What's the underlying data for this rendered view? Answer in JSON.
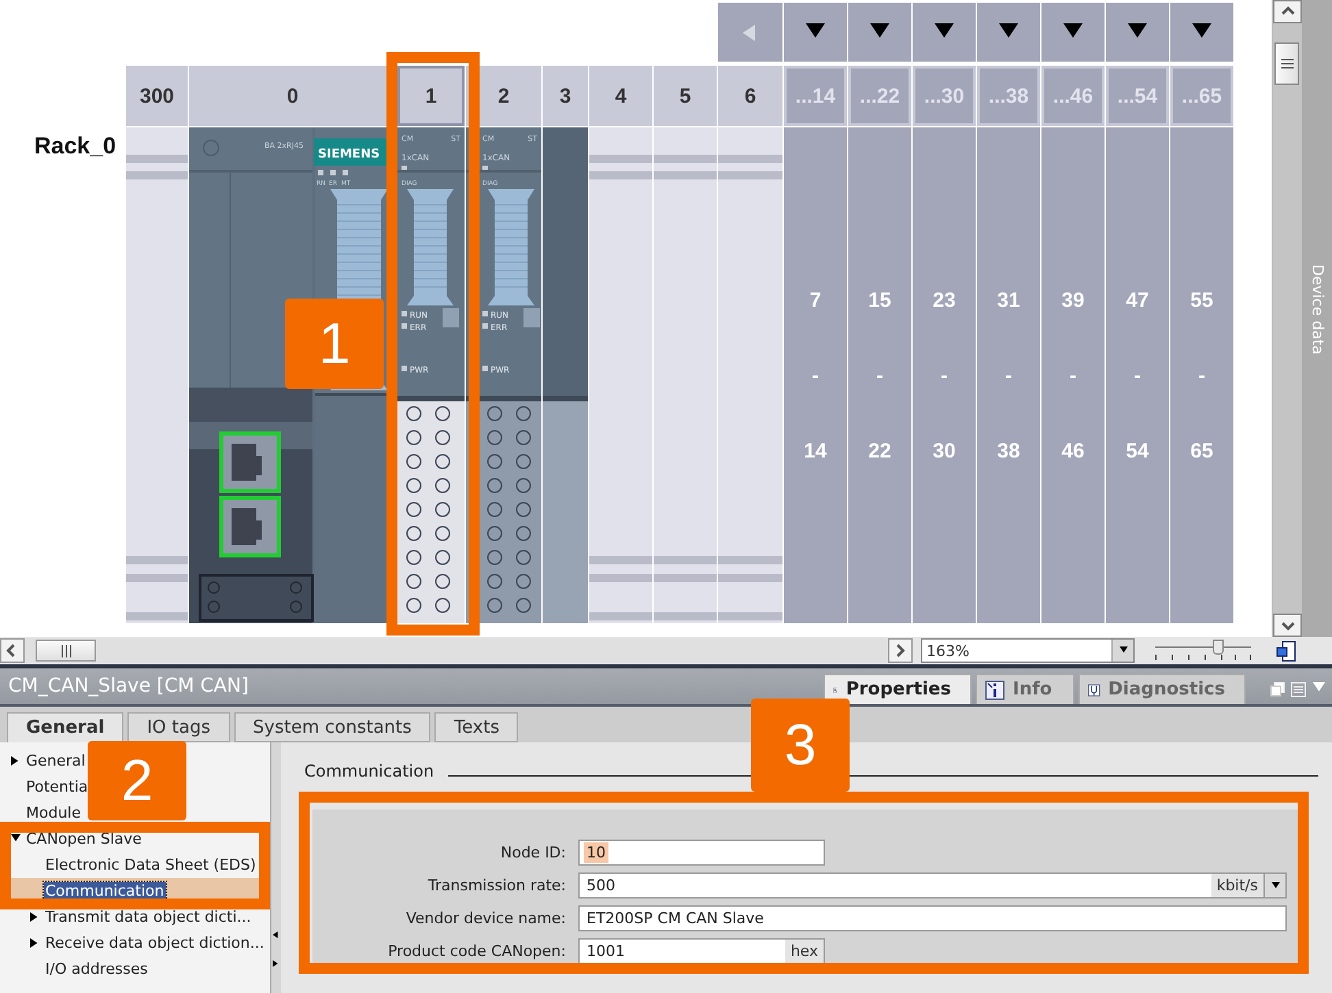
{
  "device_view": {
    "rack": {
      "name": "Rack_0",
      "slots": [
        {
          "label": "300",
          "kind": "empty",
          "selected": false
        },
        {
          "label": "0",
          "kind": "interface",
          "selected": false,
          "module": {
            "name": "BA 2xRJ45",
            "brand": "SIEMENS",
            "leds": [
              "RN",
              "ER",
              "MT"
            ]
          }
        },
        {
          "label": "1",
          "kind": "can",
          "selected": true,
          "module": {
            "class": "CM",
            "status": "ST",
            "type": "1xCAN",
            "diag": "DIAG",
            "run": "RUN",
            "err": "ERR",
            "pwr": "PWR"
          }
        },
        {
          "label": "2",
          "kind": "can",
          "selected": false,
          "module": {
            "class": "CM",
            "status": "ST",
            "type": "1xCAN",
            "diag": "DIAG",
            "run": "RUN",
            "err": "ERR",
            "pwr": "PWR"
          }
        },
        {
          "label": "3",
          "kind": "server",
          "selected": false
        },
        {
          "label": "4",
          "kind": "empty",
          "selected": false
        },
        {
          "label": "5",
          "kind": "empty",
          "selected": false
        },
        {
          "label": "6",
          "kind": "empty",
          "selected": false
        }
      ],
      "groups": [
        {
          "label": "...14",
          "from": "7",
          "dash": "-",
          "to": "14"
        },
        {
          "label": "...22",
          "from": "15",
          "dash": "-",
          "to": "22"
        },
        {
          "label": "...30",
          "from": "23",
          "dash": "-",
          "to": "30"
        },
        {
          "label": "...38",
          "from": "31",
          "dash": "-",
          "to": "38"
        },
        {
          "label": "...46",
          "from": "39",
          "dash": "-",
          "to": "46"
        },
        {
          "label": "...54",
          "from": "47",
          "dash": "-",
          "to": "54"
        },
        {
          "label": "...65",
          "from": "55",
          "dash": "-",
          "to": "65"
        }
      ]
    },
    "side_tab": "Device data",
    "zoom": {
      "value": "163%",
      "level": 0.65
    }
  },
  "inspector": {
    "title": "CM_CAN_Slave [CM CAN]",
    "views": [
      {
        "label": "Properties",
        "selected": true
      },
      {
        "label": "Info",
        "selected": false
      },
      {
        "label": "Diagnostics",
        "selected": false
      }
    ],
    "tabs": [
      {
        "label": "General",
        "selected": true
      },
      {
        "label": "IO tags",
        "selected": false
      },
      {
        "label": "System constants",
        "selected": false
      },
      {
        "label": "Texts",
        "selected": false
      }
    ],
    "tree": [
      {
        "label": "General",
        "expanded": false,
        "selected": false
      },
      {
        "label": "Potentia",
        "selected": false
      },
      {
        "label": "Module",
        "selected": false
      },
      {
        "label": "CANopen Slave",
        "expanded": true,
        "selected": false,
        "children": [
          {
            "label": "Electronic Data Sheet (EDS)",
            "selected": false
          },
          {
            "label": "Communication",
            "selected": true
          },
          {
            "label": "Transmit data object dicti...",
            "expanded": false,
            "selected": false
          },
          {
            "label": "Receive data object diction...",
            "expanded": false,
            "selected": false
          },
          {
            "label": "I/O addresses",
            "selected": false
          }
        ]
      }
    ],
    "section": "Communication",
    "fields": [
      {
        "label": "Node ID:",
        "value": "10",
        "kind": "short",
        "highlighted": true
      },
      {
        "label": "Transmission rate:",
        "value": "500",
        "kind": "dropdown",
        "unit": "kbit/s"
      },
      {
        "label": "Vendor device name:",
        "value": "ET200SP CM CAN Slave",
        "kind": "wide"
      },
      {
        "label": "Product code CANopen:",
        "value": "1001",
        "kind": "short",
        "unit": "hex"
      }
    ]
  },
  "callouts": [
    {
      "number": "1"
    },
    {
      "number": "2"
    },
    {
      "number": "3"
    }
  ]
}
